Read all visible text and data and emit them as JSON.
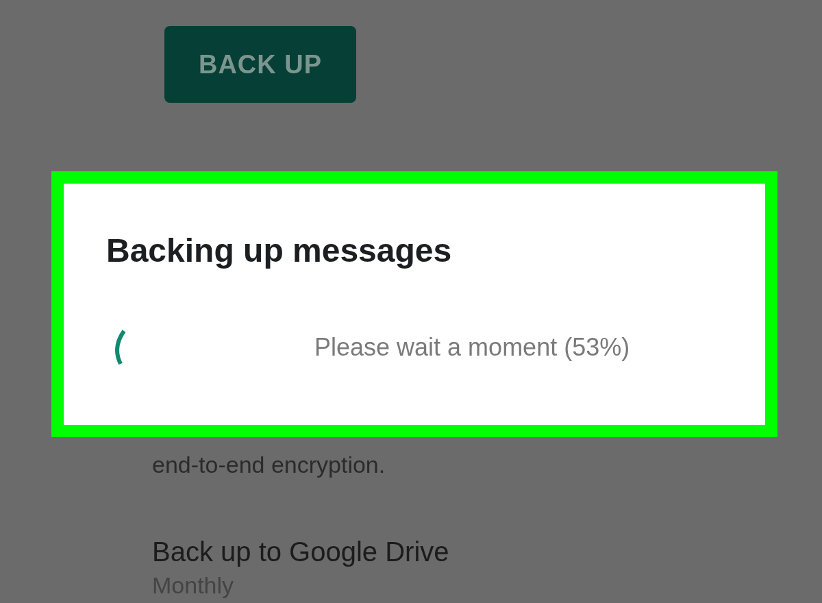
{
  "screen": {
    "backup_button": "BACK UP",
    "description_end": "end-to-end encryption.",
    "setting": {
      "title": "Back up to Google Drive",
      "value": "Monthly"
    }
  },
  "dialog": {
    "title": "Backing up messages",
    "message": "Please wait a moment (53%)"
  }
}
